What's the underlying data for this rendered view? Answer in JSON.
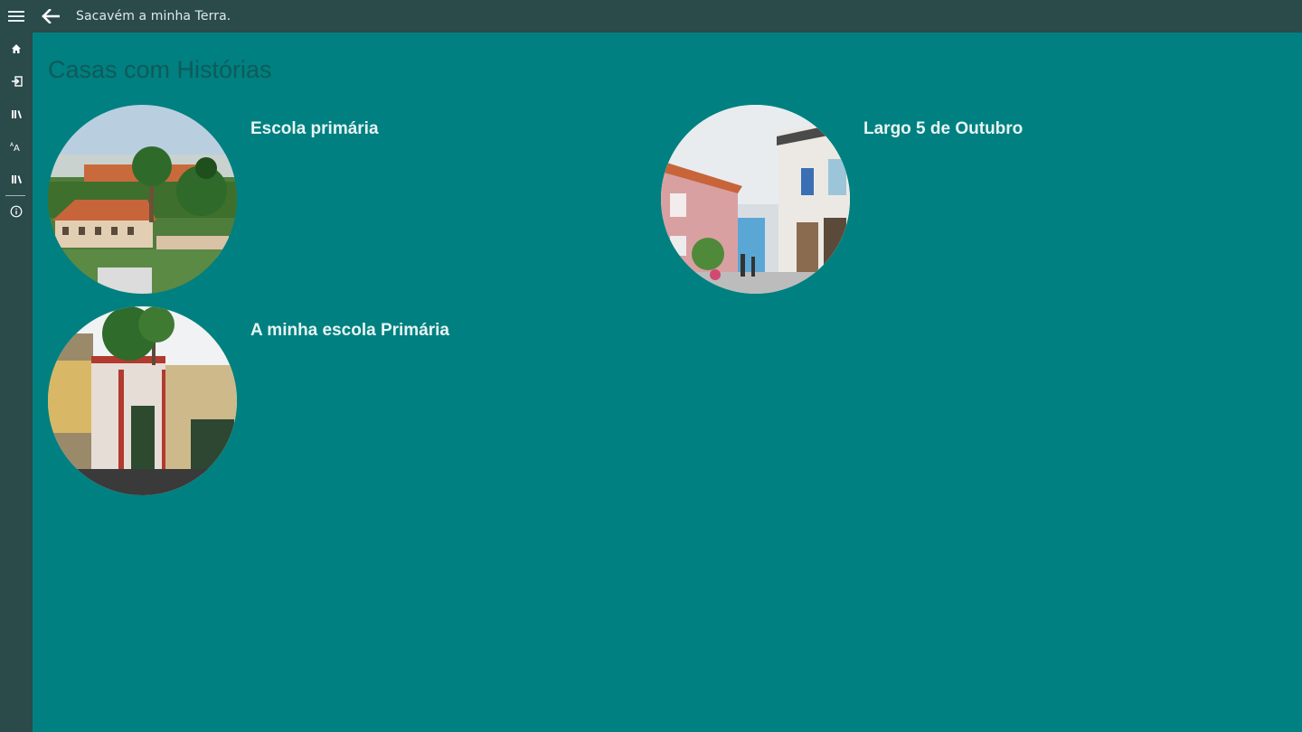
{
  "window": {
    "title": "Sacavém a minha Terra."
  },
  "sidebar": {
    "items": [
      {
        "icon": "home-icon"
      },
      {
        "icon": "sign-in-icon"
      },
      {
        "icon": "library-icon"
      },
      {
        "icon": "font-size-icon"
      },
      {
        "icon": "library-icon"
      },
      {
        "icon": "info-icon"
      }
    ]
  },
  "page": {
    "title": "Casas com Histórias"
  },
  "cards": [
    {
      "title": "Escola primária"
    },
    {
      "title": "Largo 5 de Outubro"
    },
    {
      "title": "A minha escola Primária"
    }
  ],
  "colors": {
    "background": "#008080",
    "chrome": "#2b4a4a",
    "title_text": "#0f5a5a",
    "card_text": "#e8f4f4"
  }
}
